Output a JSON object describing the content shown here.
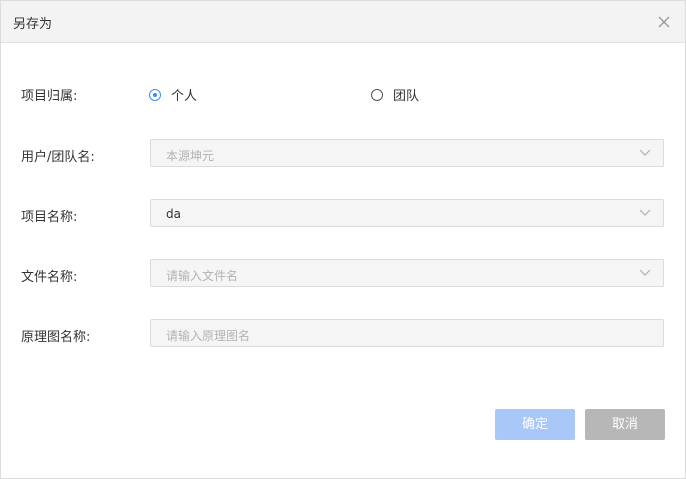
{
  "dialog": {
    "title": "另存为",
    "close_icon": "close-icon"
  },
  "form": {
    "ownership": {
      "label": "项目归属:",
      "options": [
        {
          "label": "个人",
          "checked": true
        },
        {
          "label": "团队",
          "checked": false
        }
      ]
    },
    "user_team": {
      "label": "用户/团队名:",
      "placeholder": "本源坤元"
    },
    "project_name": {
      "label": "项目名称:",
      "value": "da"
    },
    "file_name": {
      "label": "文件名称:",
      "placeholder": "请输入文件名"
    },
    "schematic_name": {
      "label": "原理图名称:",
      "placeholder": "请输入原理图名"
    }
  },
  "buttons": {
    "confirm": "确定",
    "cancel": "取消"
  },
  "colors": {
    "accent": "#3d8ef3",
    "confirm_button": "#a9c8f7",
    "cancel_button": "#b7b7b7",
    "header_bg": "#f3f3f3"
  }
}
